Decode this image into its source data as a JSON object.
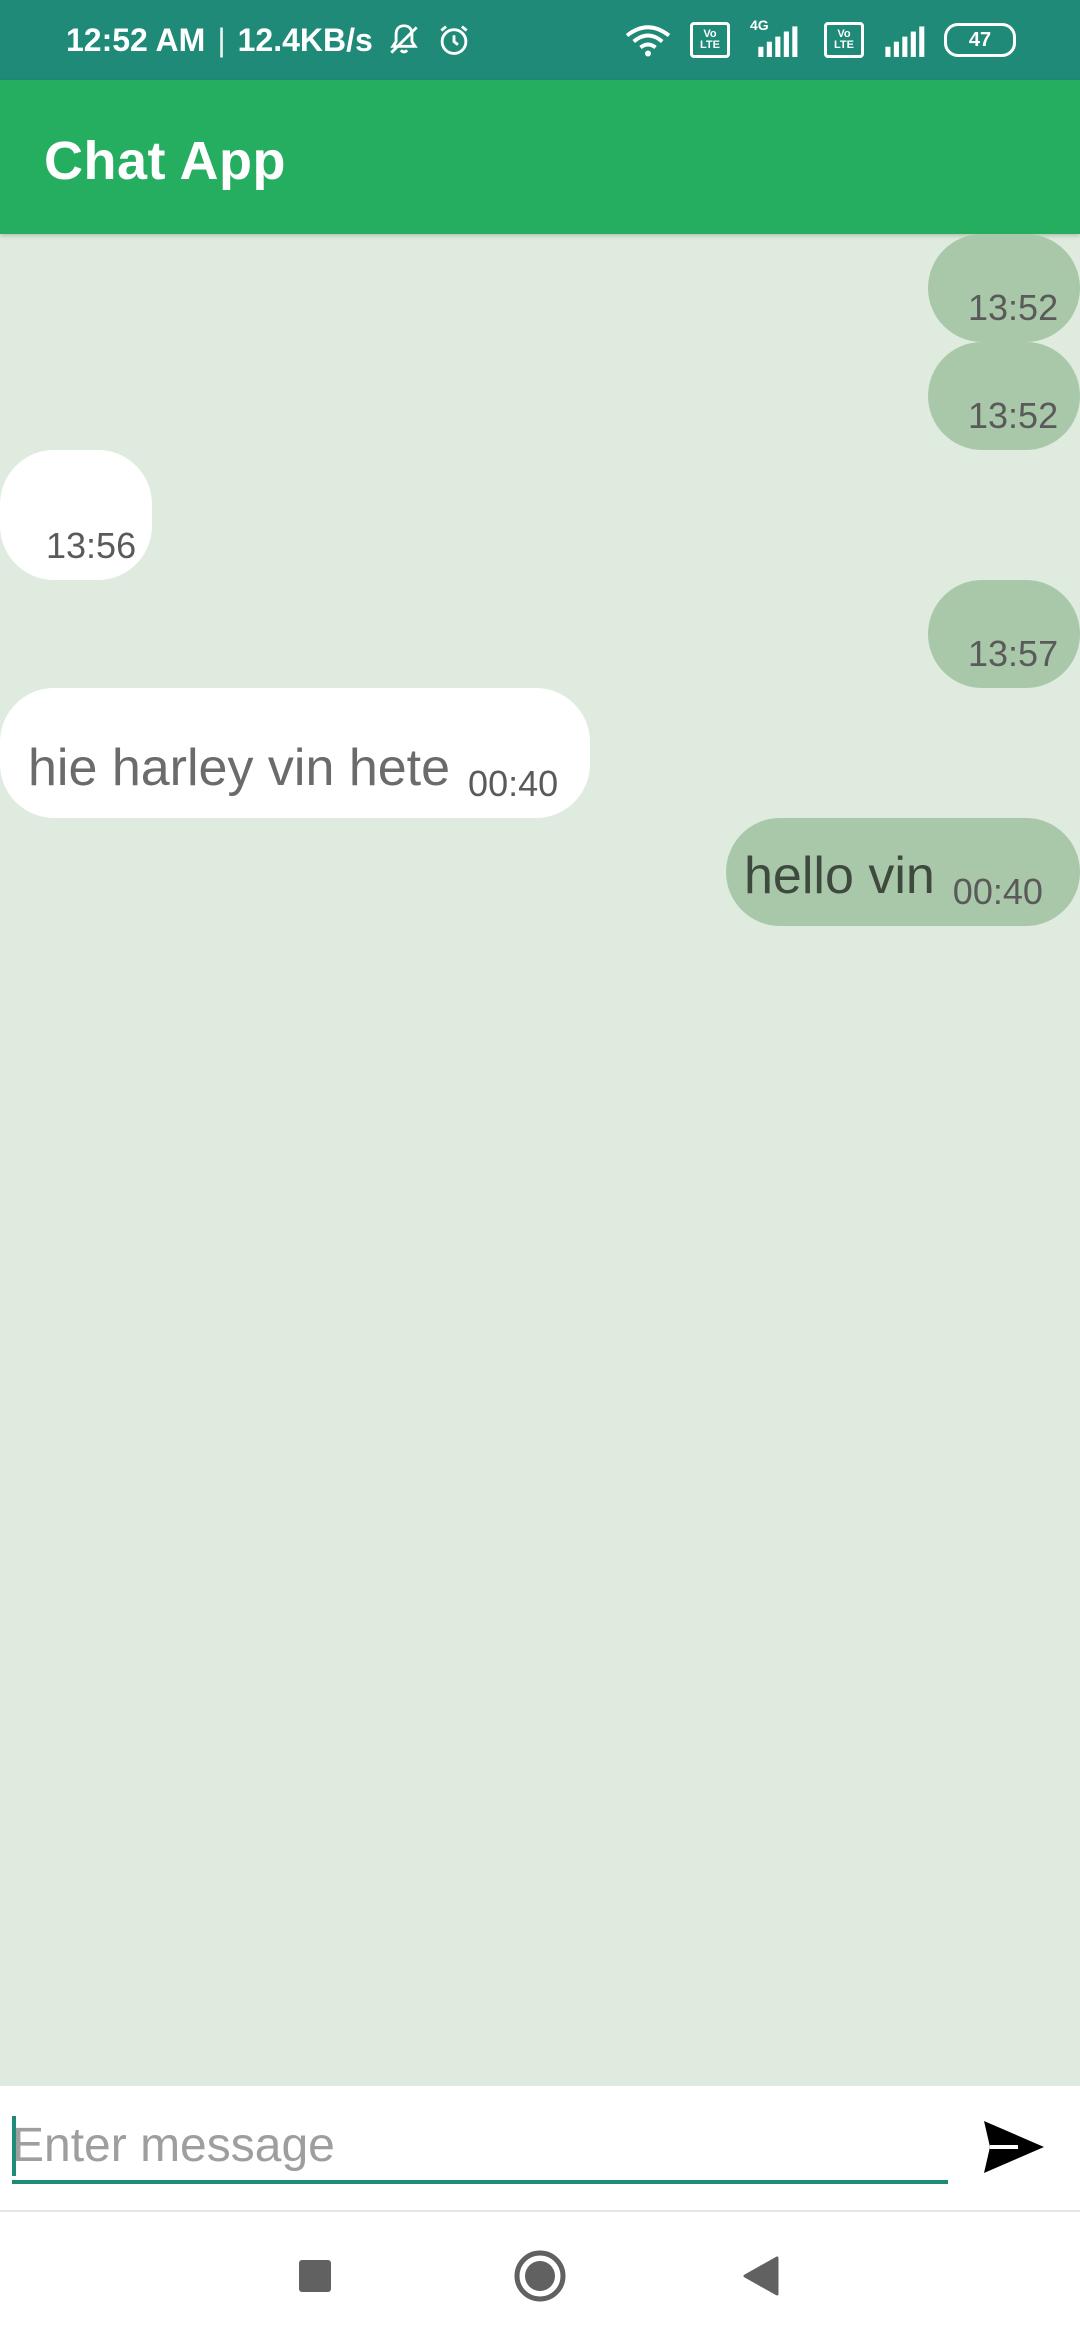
{
  "status_bar": {
    "time": "12:52 AM",
    "separator": "|",
    "network_speed": "12.4KB/s",
    "network_type": "4G",
    "volte_top": "Vo",
    "volte_bottom": "LTE",
    "battery": "47",
    "icons": [
      "mute-notifications-icon",
      "alarm-icon",
      "wifi-icon",
      "volte-icon",
      "signal-icon",
      "battery-icon"
    ]
  },
  "app_bar": {
    "title": "Chat App"
  },
  "messages": [
    {
      "type": "sent",
      "text": "",
      "time": "13:52"
    },
    {
      "type": "sent",
      "text": "",
      "time": "13:52"
    },
    {
      "type": "received",
      "text": "",
      "time": "13:56"
    },
    {
      "type": "sent",
      "text": "",
      "time": "13:57"
    },
    {
      "type": "received",
      "text": "hie harley vin hete",
      "time": "00:40"
    },
    {
      "type": "sent",
      "text": "hello vin",
      "time": "00:40"
    }
  ],
  "input": {
    "placeholder": "Enter message",
    "value": ""
  },
  "send_icon": "send-icon",
  "nav_bar": {
    "icons": [
      "recents-square-icon",
      "home-circle-icon",
      "back-triangle-icon"
    ]
  },
  "colors": {
    "status_bar": "#1f8a78",
    "app_bar": "#26ae60",
    "chat_background": "#deebde",
    "sent_bubble": "#a9c8a9",
    "received_bubble": "#ffffff",
    "accent": "#1f8a78"
  }
}
